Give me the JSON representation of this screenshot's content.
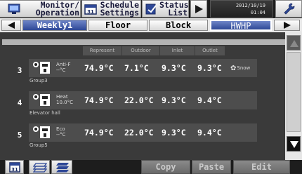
{
  "topbar": {
    "monitor_label": "Monitor/\nOperation",
    "schedule_label": "Schedule\nSettings",
    "status_label": "Status\nList",
    "clock_date": "2012/10/19",
    "clock_time": "01:04"
  },
  "tabs": {
    "weekly": "Weekly1",
    "floor": "Floor",
    "block": "Block",
    "hwhp": "HWHP"
  },
  "columns": {
    "represent": "Represent",
    "outdoor": "Outdoor",
    "inlet": "Inlet",
    "outlet": "Outlet"
  },
  "rows": [
    {
      "no": "3",
      "mode1": "Anti-F",
      "mode2": "--°C",
      "represent": "74.9°C",
      "outdoor": "7.1°C",
      "inlet": "9.3°C",
      "outlet": "9.3°C",
      "extra": "Snow",
      "group": "Group3"
    },
    {
      "no": "4",
      "mode1": "Heat",
      "mode2": "10.0°C",
      "represent": "74.9°C",
      "outdoor": "22.0°C",
      "inlet": "9.3°C",
      "outlet": "9.4°C",
      "extra": "",
      "group": "Elevator hall"
    },
    {
      "no": "5",
      "mode1": "Eco",
      "mode2": "--°C",
      "represent": "74.9°C",
      "outdoor": "22.0°C",
      "inlet": "9.3°C",
      "outlet": "9.4°C",
      "extra": "",
      "group": "Group5"
    }
  ],
  "bottombar": {
    "copy": "Copy",
    "paste": "Paste",
    "edit": "Edit"
  },
  "colors": {
    "accent": "#2d4796",
    "panel": "#4d4d4d",
    "background": "#3a3a3a"
  },
  "icons": [
    "monitor-icon",
    "calendar-icon",
    "list-icon",
    "wrench-icon",
    "snowflake-icon",
    "water-heater-icon",
    "layers-icon"
  ]
}
